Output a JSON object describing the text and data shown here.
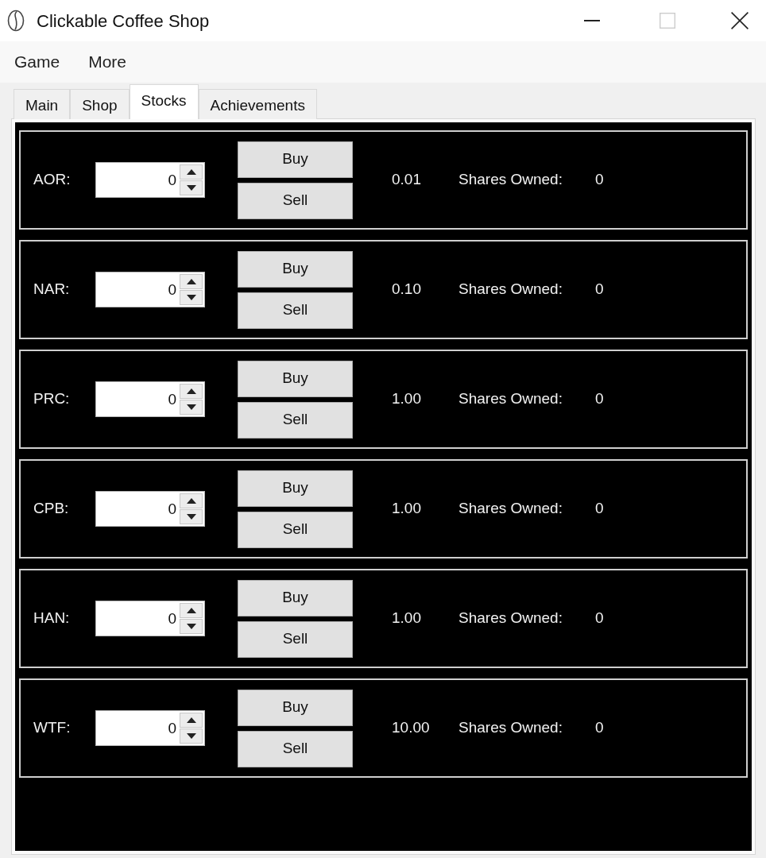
{
  "window": {
    "title": "Clickable Coffee Shop",
    "controls": [
      {
        "kind": "minimize",
        "disabled": false
      },
      {
        "kind": "maximize",
        "disabled": true
      },
      {
        "kind": "close",
        "disabled": false
      }
    ]
  },
  "menu": [
    "Game",
    "More"
  ],
  "tabs": [
    {
      "label": "Main",
      "selected": false
    },
    {
      "label": "Shop",
      "selected": false
    },
    {
      "label": "Stocks",
      "selected": true
    },
    {
      "label": "Achievements",
      "selected": false
    }
  ],
  "stocks": [
    {
      "symbol": "AOR:",
      "quantity": "0",
      "buy": "Buy",
      "sell": "Sell",
      "price": "0.01",
      "owned_label": "Shares Owned:",
      "owned": "0"
    },
    {
      "symbol": "NAR:",
      "quantity": "0",
      "buy": "Buy",
      "sell": "Sell",
      "price": "0.10",
      "owned_label": "Shares Owned:",
      "owned": "0"
    },
    {
      "symbol": "PRC:",
      "quantity": "0",
      "buy": "Buy",
      "sell": "Sell",
      "price": "1.00",
      "owned_label": "Shares Owned:",
      "owned": "0"
    },
    {
      "symbol": "CPB:",
      "quantity": "0",
      "buy": "Buy",
      "sell": "Sell",
      "price": "1.00",
      "owned_label": "Shares Owned:",
      "owned": "0"
    },
    {
      "symbol": "HAN:",
      "quantity": "0",
      "buy": "Buy",
      "sell": "Sell",
      "price": "1.00",
      "owned_label": "Shares Owned:",
      "owned": "0"
    },
    {
      "symbol": "WTF:",
      "quantity": "0",
      "buy": "Buy",
      "sell": "Sell",
      "price": "10.00",
      "owned_label": "Shares Owned:",
      "owned": "0"
    }
  ]
}
